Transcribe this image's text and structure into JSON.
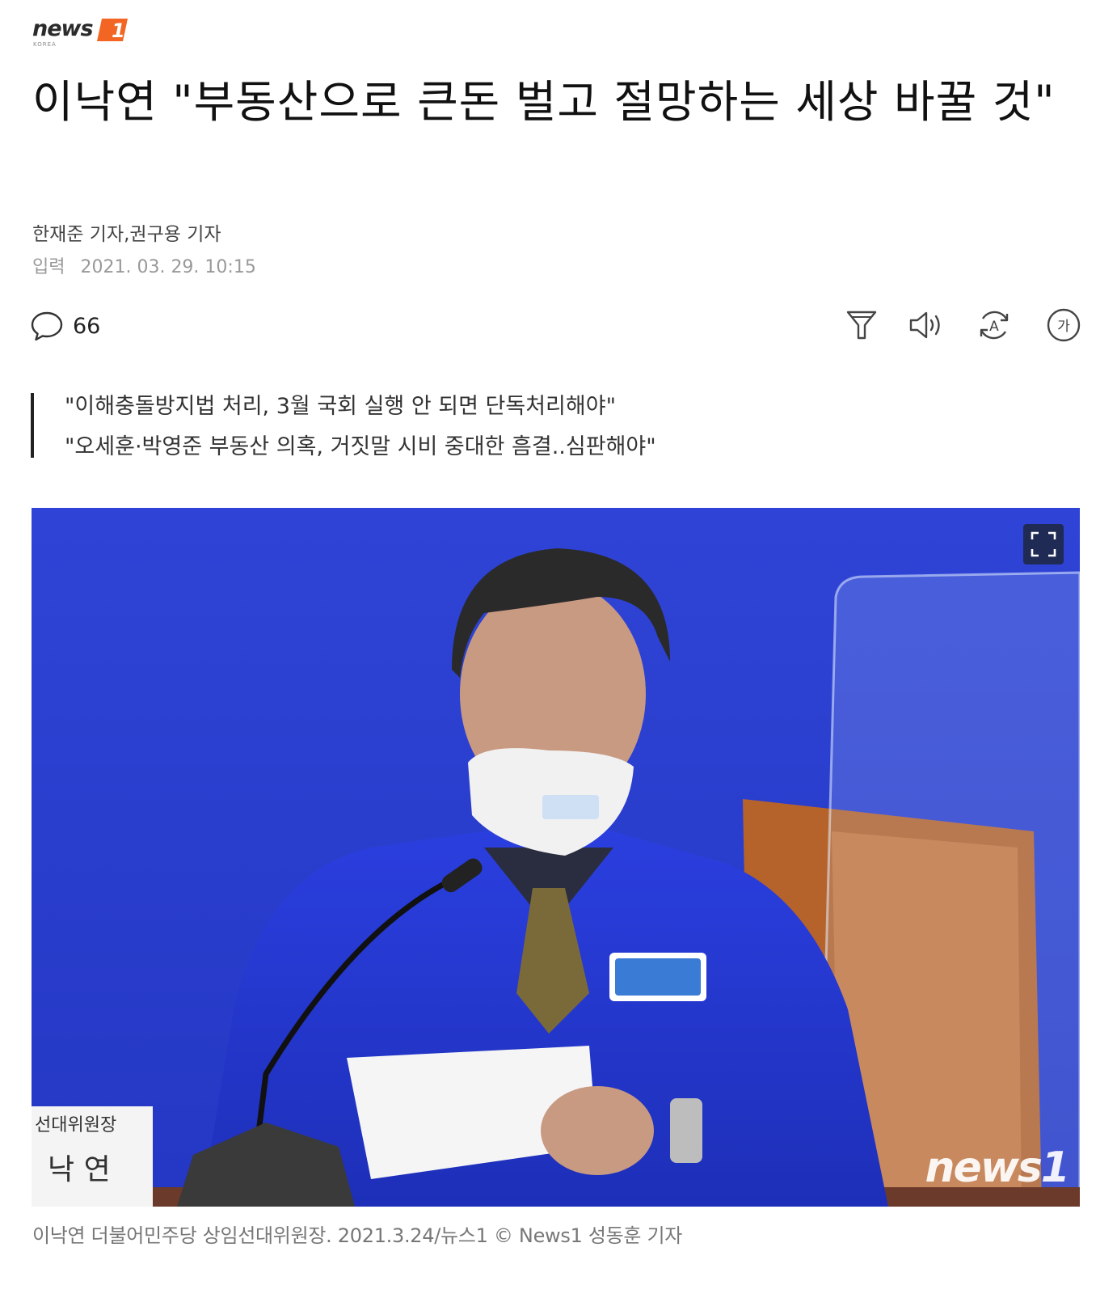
{
  "header": {
    "logo_text": "news",
    "logo_badge": "1",
    "logo_sub": "KOREA",
    "brand_color": "#f26522"
  },
  "article": {
    "title": "이낙연 \"부동산으로 큰돈 벌고 절망하는 세상 바꿀 것\"",
    "byline": "한재준 기자,권구용 기자",
    "date_label": "입력",
    "date_value": "2021. 03. 29. 10:15",
    "comment_count": "66",
    "toolbar_icons": [
      "recommend-icon",
      "speaker-icon",
      "translate-icon",
      "font-size-icon"
    ],
    "font_icon_glyph": "가",
    "translate_icon_glyph": "A",
    "summary": [
      "\"이해충돌방지법 처리, 3월 국회 실행 안 되면 단독처리해야\"",
      "\"오세훈·박영준 부동산 의혹, 거짓말 시비 중대한 흠결..심판해야\""
    ],
    "photo": {
      "watermark": "news1",
      "caption": "이낙연 더불어민주당 상임선대위원장. 2021.3.24/뉴스1 © News1 성동훈 기자"
    }
  }
}
